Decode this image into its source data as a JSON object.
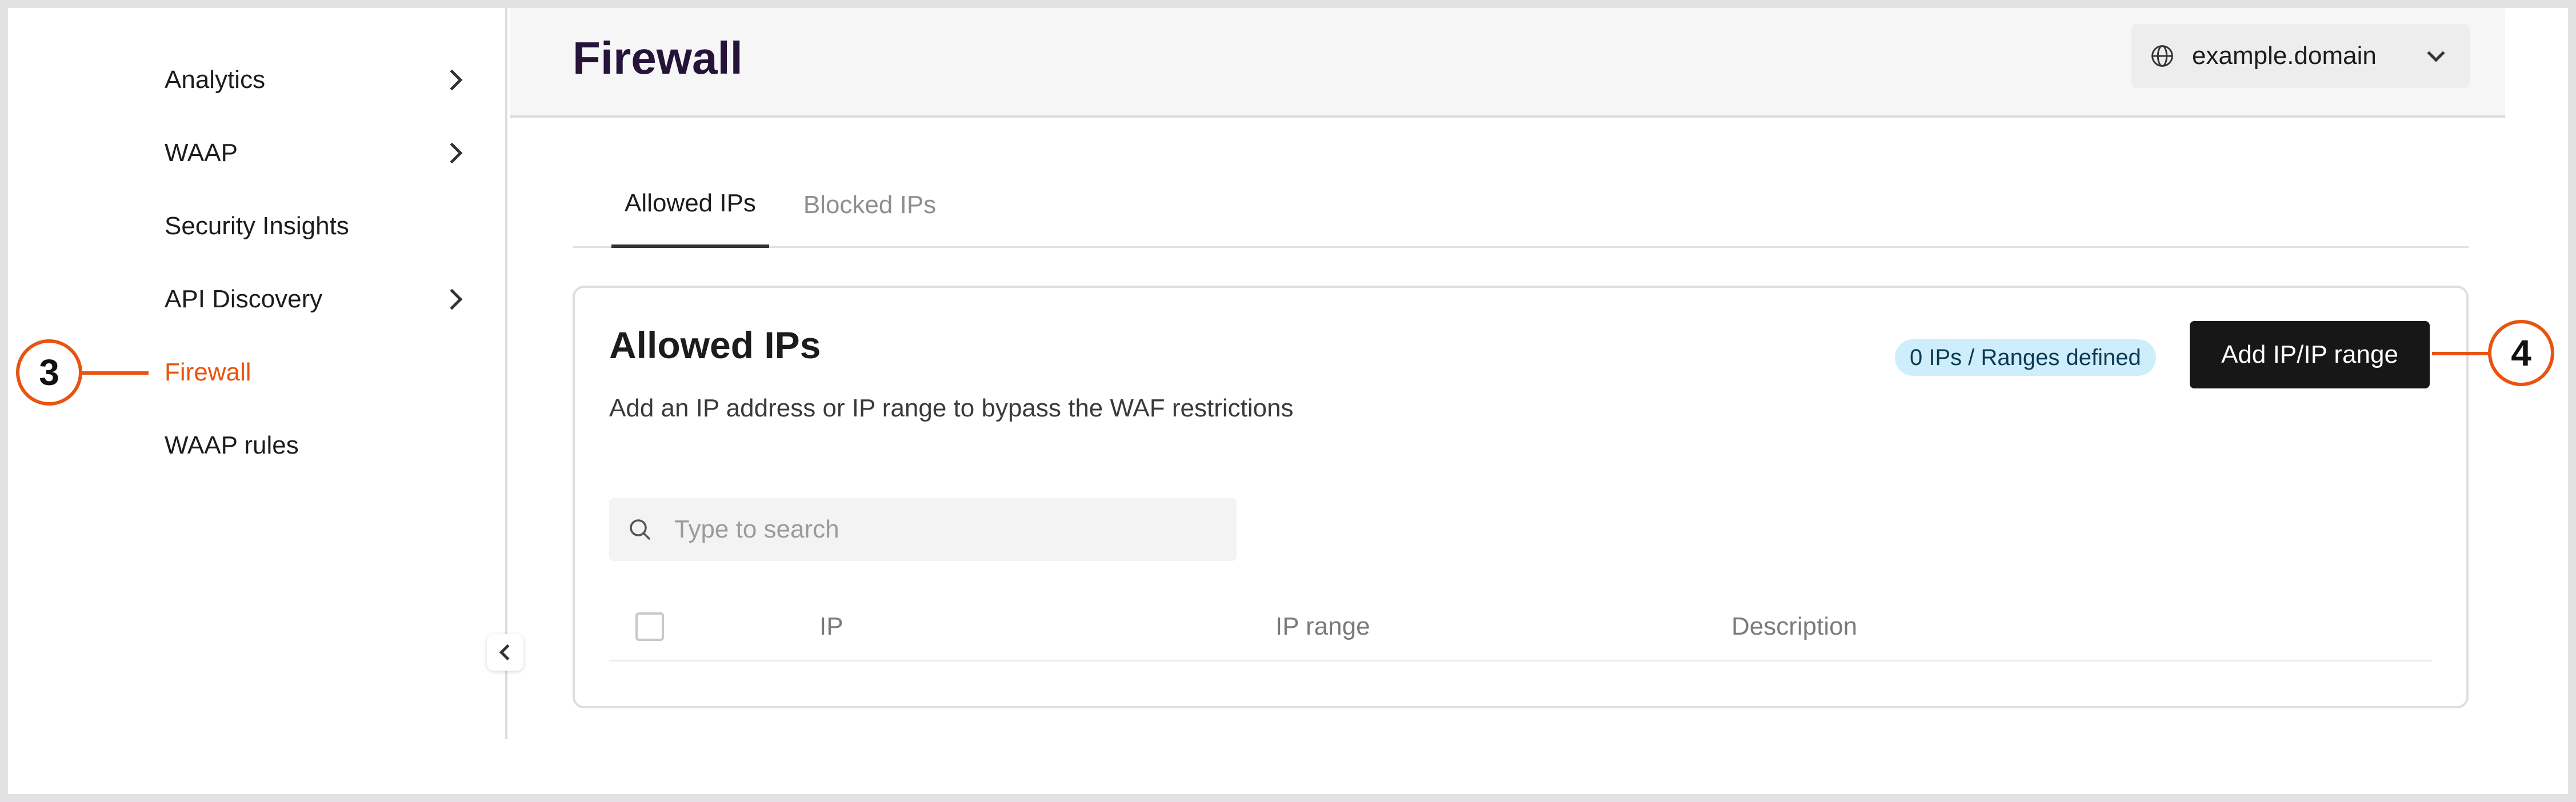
{
  "sidebar": {
    "items": [
      {
        "label": "Analytics",
        "has_chevron": true
      },
      {
        "label": "WAAP",
        "has_chevron": true
      },
      {
        "label": "Security Insights",
        "has_chevron": false
      },
      {
        "label": "API Discovery",
        "has_chevron": true
      },
      {
        "label": "Firewall",
        "has_chevron": false,
        "active": true
      },
      {
        "label": "WAAP rules",
        "has_chevron": false
      }
    ],
    "collapse_icon": "chevron-left-icon"
  },
  "header": {
    "title": "Firewall",
    "domain_select": {
      "icon": "globe-icon",
      "value": "example.domain"
    }
  },
  "tabs": [
    {
      "label": "Allowed IPs",
      "active": true
    },
    {
      "label": "Blocked IPs",
      "active": false
    }
  ],
  "card": {
    "title": "Allowed IPs",
    "description": "Add an IP address or IP range to bypass the WAF restrictions",
    "badge": "0 IPs / Ranges defined",
    "add_button": "Add IP/IP range",
    "search": {
      "placeholder": "Type to search",
      "value": ""
    },
    "table": {
      "columns": [
        "IP",
        "IP range",
        "Description"
      ]
    }
  },
  "callouts": [
    "3",
    "4"
  ],
  "colors": {
    "accent": "#e8540f",
    "title": "#25133a",
    "badge_bg": "#cdeefa",
    "button_bg": "#171717"
  }
}
